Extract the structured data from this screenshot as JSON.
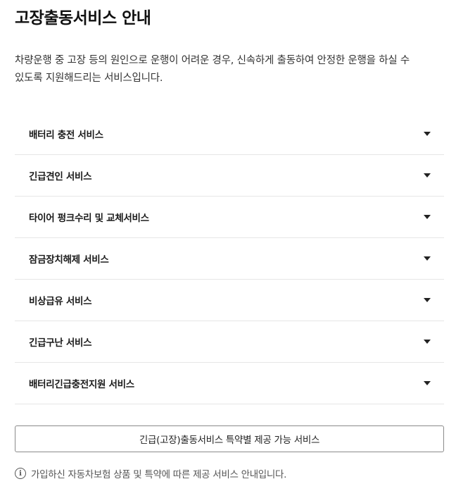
{
  "header": {
    "title": "고장출동서비스 안내"
  },
  "intro": {
    "line1": "차량운행 중 고장 등의 원인으로 운행이 어려운 경우, 신속하게 출동하여 안정한 운행을 하실 수",
    "line2": "있도록 지원해드리는 서비스입니다."
  },
  "services": [
    {
      "label": "배터리 충전 서비스",
      "icon": "chevron-down-icon"
    },
    {
      "label": "긴급견인 서비스",
      "icon": "chevron-down-icon"
    },
    {
      "label": "타이어 펑크수리 및 교체서비스",
      "icon": "chevron-down-icon"
    },
    {
      "label": "잠금장치해제 서비스",
      "icon": "chevron-down-icon"
    },
    {
      "label": "비상급유 서비스",
      "icon": "chevron-down-icon"
    },
    {
      "label": "긴급구난 서비스",
      "icon": "chevron-down-icon"
    },
    {
      "label": "배터리긴급충전지원 서비스",
      "icon": "chevron-down-icon"
    }
  ],
  "special_button": {
    "label": "긴급(고장)출동서비스 특약별 제공 가능 서비스"
  },
  "notice": {
    "icon": "info-icon",
    "text": "가입하신 자동차보험 상품 및 특약에 따른 제공 서비스 안내입니다."
  }
}
